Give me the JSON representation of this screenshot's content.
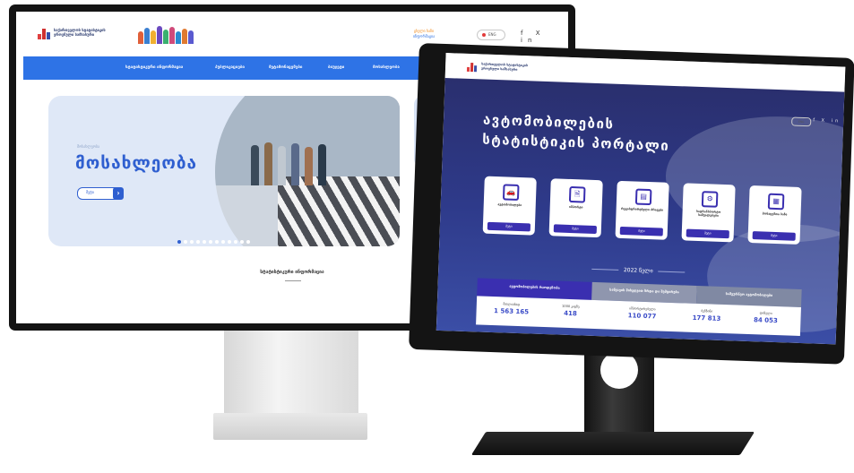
{
  "left_site": {
    "org_name": "საქართველოს სტატისტიკის ეროვნული სამსახური",
    "hotline_1": "ცხელი ხაზი",
    "hotline_2": "ინფორმაცია",
    "lang": "ENG",
    "social": "f X in",
    "nav": [
      "სტატისტიკური ინფორმაცია",
      "პუბლიკაციები",
      "მეტამონაცემები",
      "ბიუჯეტი",
      "მოსახლეობა",
      "სიახლე"
    ],
    "hero_kicker": "მოსახლეობა",
    "hero_title": "მოსახლეობა",
    "more_label": "მეტი",
    "section_title": "სტატისტიკური ინფორმაცია",
    "slide_count": 12,
    "active_slide": 1
  },
  "right_site": {
    "org_name": "საქართველოს სტატისტიკის ეროვნული სამსახური",
    "lang": "ENG",
    "social": "f X in",
    "title_line1": "ავტომობილების",
    "title_line2": "სტატისტიკის პორტალი",
    "cards": [
      {
        "icon": "car-icon",
        "glyph": "🚗",
        "label": "ავტომობილები",
        "button": "მეტი"
      },
      {
        "icon": "document-icon",
        "glyph": "🗎",
        "label": "იმპორტი",
        "button": "მეტი"
      },
      {
        "icon": "clipboard-icon",
        "glyph": "▤",
        "label": "რეგისტრირებული ძრავები",
        "button": "მეტი"
      },
      {
        "icon": "gear-car-icon",
        "glyph": "⚙",
        "label": "სატრანსპორტო საშუალებები",
        "button": "მეტი"
      },
      {
        "icon": "calculator-icon",
        "glyph": "▦",
        "label": "მონაცემთა ბაზა",
        "button": "მეტი"
      }
    ],
    "year_label": "2022 წელი",
    "tabs": [
      {
        "label": "ავტომობილების რაოდენობა",
        "active": true
      },
      {
        "label": "საწვავის მიხედვით ზრდა და შემცირება",
        "active": false
      },
      {
        "label": "სამეურნეო ავტომობილები",
        "active": false
      }
    ],
    "stats": [
      {
        "key": "მთლიანად",
        "value": "1 563 165"
      },
      {
        "key": "1000 კაცზე",
        "value": "418"
      },
      {
        "key": "იმპორტირებული",
        "value": "110 077"
      },
      {
        "key": "ბენზინი",
        "value": "177 813"
      },
      {
        "key": "დიზელი",
        "value": "84 053"
      }
    ],
    "pager_count": 3,
    "pager_active": 1
  },
  "colors": {
    "left_nav": "#2e73e6",
    "left_title": "#2f5fd0",
    "right_bg": "#2e3a8a",
    "right_accent": "#3a2fb0"
  }
}
